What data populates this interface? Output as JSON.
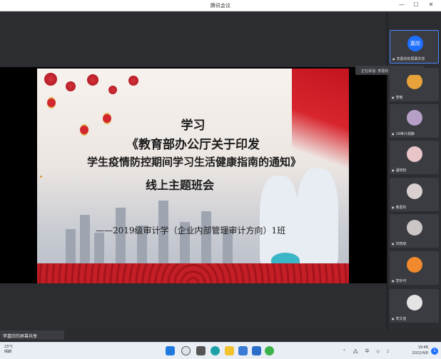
{
  "window": {
    "title": "腾讯会议",
    "min": "—",
    "max": "☐",
    "close": "✕"
  },
  "slide": {
    "line1": "学习",
    "line2": "《教育部办公厅关于印发",
    "line3": "学生疫情防控期间学习生活健康指南的通知》",
    "line4": "线上主题班会",
    "subtitle": "——2019级审计学（企业内部管理审计方向）1班"
  },
  "speaking": "正在讲话: 李嘉欣",
  "participants": [
    {
      "avatar_text": "嘉欣",
      "name": "李嘉欣的屏幕共享",
      "color": "#1e6fff"
    },
    {
      "avatar_text": "",
      "name": "李敏",
      "color": "#e8a23a"
    },
    {
      "avatar_text": "",
      "name": "19审计胡静",
      "color": "#b7a0c8"
    },
    {
      "avatar_text": "",
      "name": "温晓怡",
      "color": "#e9c4c9"
    },
    {
      "avatar_text": "",
      "name": "黄嘉利",
      "color": "#d9d0cf"
    },
    {
      "avatar_text": "",
      "name": "刘晓琼",
      "color": "#ccc5c6"
    },
    {
      "avatar_text": "",
      "name": "李妙可",
      "color": "#f08a2c"
    },
    {
      "avatar_text": "",
      "name": "李文迪",
      "color": "#e4e4e4"
    }
  ],
  "share_bar": "李嘉欣的屏幕共享",
  "taskbar": {
    "weather_temp": "23°C",
    "weather_desc": "晴朗",
    "tray_icons": "⌃ 🖧 中 ◇ ♪",
    "time": "19:48",
    "date": "2022/4/8",
    "notifications": "1"
  },
  "colors": {
    "accent": "#1e6fff",
    "slide_red": "#c41e26"
  }
}
